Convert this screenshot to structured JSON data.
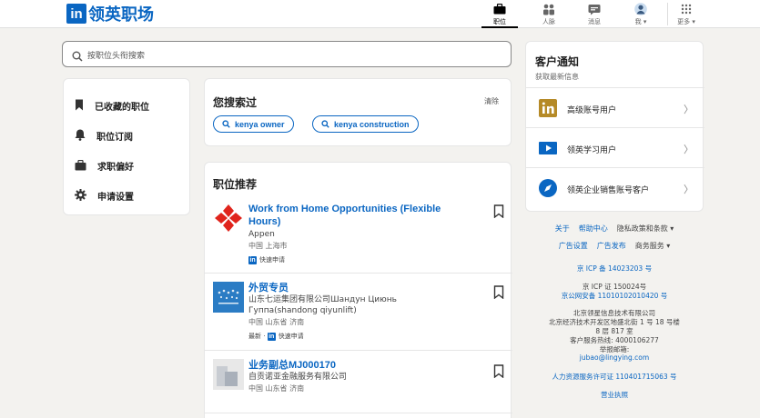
{
  "brand": {
    "logo_mark": "in",
    "name": "领英职场"
  },
  "nav": [
    {
      "label": "职位",
      "icon": "briefcase-icon",
      "active": true
    },
    {
      "label": "人脉",
      "icon": "people-icon"
    },
    {
      "label": "消息",
      "icon": "message-icon"
    },
    {
      "label": "我",
      "icon": "avatar-icon"
    },
    {
      "label": "更多",
      "icon": "grid-icon"
    }
  ],
  "search": {
    "placeholder": "按职位头衔搜索"
  },
  "sidebar": {
    "items": [
      {
        "label": "已收藏的职位",
        "icon": "bookmark-icon"
      },
      {
        "label": "职位订阅",
        "icon": "bell-icon"
      },
      {
        "label": "求职偏好",
        "icon": "briefcase-icon"
      },
      {
        "label": "申请设置",
        "icon": "gear-icon"
      }
    ]
  },
  "recent": {
    "title": "您搜索过",
    "clear": "清除",
    "pills": [
      "kenya owner",
      "kenya construction"
    ]
  },
  "jobs": {
    "title": "职位推荐",
    "items": [
      {
        "title": "Work from Home Opportunities (Flexible Hours)",
        "company": "Appen",
        "location": "中国 上海市",
        "meta": "快速申请"
      },
      {
        "title": "外贸专员",
        "company": "山东七运集团有限公司Шандун Циюнь Гyппа(shandong qiyunlift)",
        "location": "中国 山东省 济南",
        "meta_prefix": "最新 ·",
        "meta": "快速申请"
      },
      {
        "title": "业务副总MJ000170",
        "company": "自贡诺亚金融服务有限公司",
        "location": "中国 山东省 济南"
      }
    ]
  },
  "notice": {
    "title": "客户通知",
    "subtitle": "获取最新信息",
    "rows": [
      {
        "label": "高级账号用户",
        "icon": "linkedin-icon"
      },
      {
        "label": "领英学习用户",
        "icon": "play-icon"
      },
      {
        "label": "领英企业销售账号客户",
        "icon": "compass-icon"
      }
    ]
  },
  "footer": {
    "links1": [
      "关于",
      "帮助中心",
      "隐私政策和条款"
    ],
    "links2": [
      "广告设置",
      "广告发布",
      "商务服务"
    ],
    "icp1": "京 ICP 备 14023203 号",
    "icp2": "京 ICP 证 150024号",
    "police": "京公网安备 11010102010420 号",
    "company": "北京领星信息技术有限公司",
    "address1": "北京经济技术开发区地盛北街 1 号 18 号楼",
    "address2": "8 层 817 室",
    "hotline": "客户服务热线: 4000106277",
    "report": "举报邮箱:",
    "email": "jubao@lingying.com",
    "hr_license": "人力资源服务许可证 110401715063 号",
    "biz_license": "营业执照"
  }
}
